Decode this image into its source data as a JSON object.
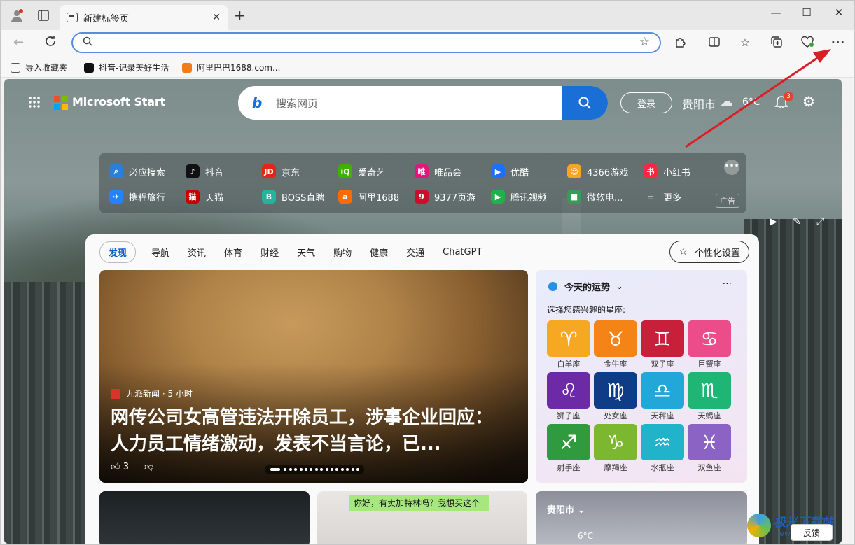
{
  "tab": {
    "title": "新建标签页",
    "close": "✕",
    "new_tab": "+"
  },
  "window": {
    "minimize": "—",
    "maximize": "☐",
    "close": "✕"
  },
  "address": {
    "placeholder": "",
    "value": ""
  },
  "bookmarks": [
    {
      "label": "导入收藏夹",
      "color": "#555555"
    },
    {
      "label": "抖音-记录美好生活",
      "color": "#111111"
    },
    {
      "label": "阿里巴巴1688.com...",
      "color": "#f07d1a"
    }
  ],
  "start": {
    "brand": "Microsoft Start",
    "search_placeholder": "搜索网页",
    "login": "登录",
    "city": "贵阳市",
    "temp": "6°C",
    "notifications": "3"
  },
  "quick_links": [
    {
      "label": "必应搜索",
      "color": "#2a7fd8",
      "glyph": "⌕"
    },
    {
      "label": "抖音",
      "color": "#111111",
      "glyph": "♪"
    },
    {
      "label": "京东",
      "color": "#e1251b",
      "glyph": "JD"
    },
    {
      "label": "爱奇艺",
      "color": "#3fb200",
      "glyph": "iQ"
    },
    {
      "label": "唯品会",
      "color": "#e6157c",
      "glyph": "唯"
    },
    {
      "label": "优酷",
      "color": "#1f6fff",
      "glyph": "▶"
    },
    {
      "label": "4366游戏",
      "color": "#f6a623",
      "glyph": "☺"
    },
    {
      "label": "小红书",
      "color": "#ff2442",
      "glyph": "书"
    },
    {
      "label": "携程旅行",
      "color": "#2681ff",
      "glyph": "✈"
    },
    {
      "label": "天猫",
      "color": "#c40000",
      "glyph": "猫"
    },
    {
      "label": "BOSS直聘",
      "color": "#26b39d",
      "glyph": "B"
    },
    {
      "label": "阿里1688",
      "color": "#ff6a00",
      "glyph": "a"
    },
    {
      "label": "9377页游",
      "color": "#c8102e",
      "glyph": "9"
    },
    {
      "label": "腾讯视频",
      "color": "#20b14b",
      "glyph": "▶"
    },
    {
      "label": "微软电...",
      "color": "#3a9a57",
      "glyph": "■"
    },
    {
      "label": "更多",
      "color": "transparent",
      "glyph": "☰"
    }
  ],
  "quick_more": "•••",
  "ad_label": "广告",
  "feed": {
    "tabs": [
      "发现",
      "导航",
      "资讯",
      "体育",
      "财经",
      "天气",
      "购物",
      "健康",
      "交通",
      "ChatGPT"
    ],
    "personalize": "个性化设置",
    "hero": {
      "source": "九派新闻 · 5 小时",
      "headline": "网传公司女高管违法开除员工，涉事企业回应：人力员工情绪激动，发表不当言论，已...",
      "likes": "3"
    },
    "horoscope": {
      "title": "今天的运势",
      "subtitle": "选择您感兴趣的星座:",
      "more": "···",
      "signs": [
        {
          "name": "白羊座",
          "glyph": "♈",
          "color": "#f7a823"
        },
        {
          "name": "金牛座",
          "glyph": "♉",
          "color": "#f48416"
        },
        {
          "name": "双子座",
          "glyph": "♊",
          "color": "#c8203b"
        },
        {
          "name": "巨蟹座",
          "glyph": "♋",
          "color": "#ec4c8a"
        },
        {
          "name": "狮子座",
          "glyph": "♌",
          "color": "#6d2aa6"
        },
        {
          "name": "处女座",
          "glyph": "♍",
          "color": "#0e3c86"
        },
        {
          "name": "天秤座",
          "glyph": "♎",
          "color": "#22a7d8"
        },
        {
          "name": "天蝎座",
          "glyph": "♏",
          "color": "#1fb575"
        },
        {
          "name": "射手座",
          "glyph": "♐",
          "color": "#2f9a3e"
        },
        {
          "name": "摩羯座",
          "glyph": "♑",
          "color": "#7cb82f"
        },
        {
          "name": "水瓶座",
          "glyph": "♒",
          "color": "#21b3c9"
        },
        {
          "name": "双鱼座",
          "glyph": "♓",
          "color": "#8b63c5"
        }
      ]
    },
    "card2_message": "你好，有卖加特林吗？我想买这个",
    "weather_card": {
      "city": "贵阳市",
      "temp": "6°C"
    }
  },
  "feedback": "反馈",
  "watermark": {
    "title": "极光下载站",
    "url": "www.xz7.com"
  }
}
